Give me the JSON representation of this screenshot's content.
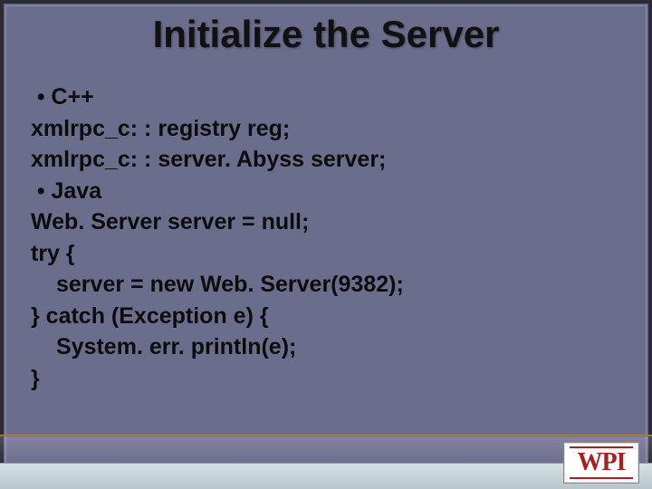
{
  "title": "Initialize the Server",
  "bullets": {
    "cpp_label": "C++",
    "java_label": "Java"
  },
  "code": {
    "cpp1": "xmlrpc_c: : registry reg;",
    "cpp2": "xmlrpc_c: : server. Abyss server;",
    "java1": "Web. Server server = null;",
    "java2": "try {",
    "java3": "server = new Web. Server(9382);",
    "java4": "} catch (Exception e) {",
    "java5": "System. err. println(e);",
    "java6": "}"
  },
  "logo": {
    "text": "WPI"
  }
}
